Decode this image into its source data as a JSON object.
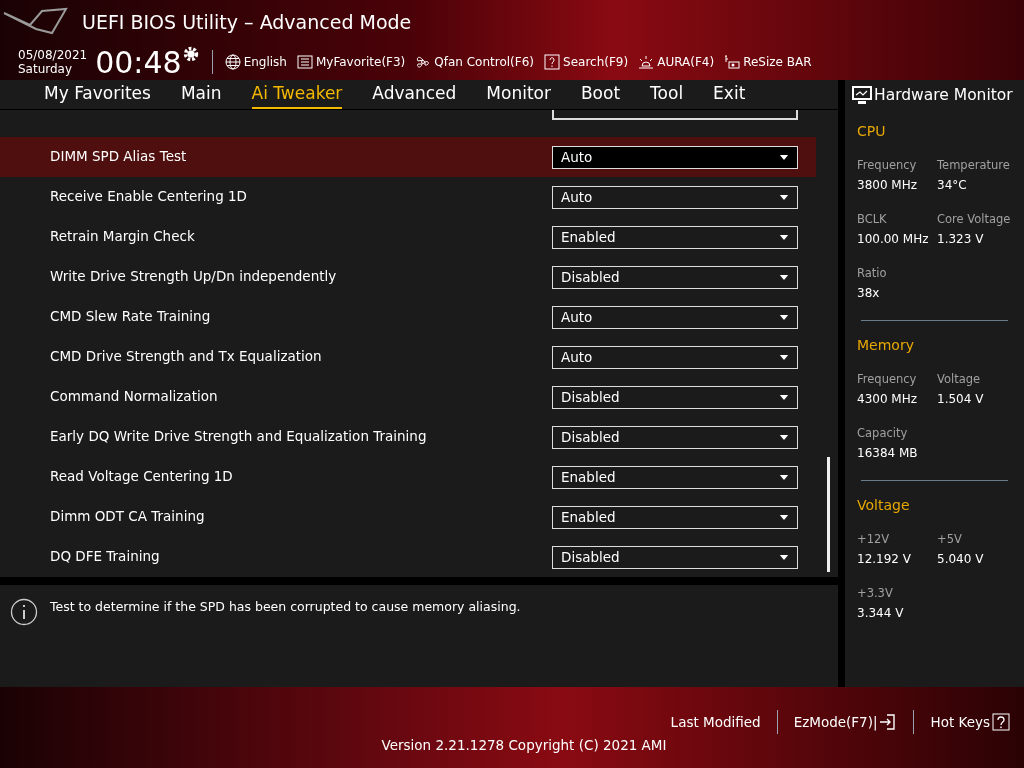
{
  "header": {
    "title": "UEFI BIOS Utility – Advanced Mode",
    "date": "05/08/2021",
    "day": "Saturday",
    "time": "00:48",
    "tools": [
      {
        "kind": "globe",
        "label": "English"
      },
      {
        "kind": "favorite",
        "label": "MyFavorite(F3)"
      },
      {
        "kind": "fan",
        "label": "Qfan Control(F6)"
      },
      {
        "kind": "search",
        "label": "Search(F9)"
      },
      {
        "kind": "aura",
        "label": "AURA(F4)"
      },
      {
        "kind": "resize",
        "label": "ReSize BAR"
      }
    ]
  },
  "tabs": [
    {
      "label": "My Favorites",
      "selected": false
    },
    {
      "label": "Main",
      "selected": false
    },
    {
      "label": "Ai Tweaker",
      "selected": true
    },
    {
      "label": "Advanced",
      "selected": false
    },
    {
      "label": "Monitor",
      "selected": false
    },
    {
      "label": "Boot",
      "selected": false
    },
    {
      "label": "Tool",
      "selected": false
    },
    {
      "label": "Exit",
      "selected": false
    }
  ],
  "settings": [
    {
      "label": "DIMM SPD Alias Test",
      "value": "Auto",
      "selected": true
    },
    {
      "label": "Receive Enable Centering 1D",
      "value": "Auto",
      "selected": false
    },
    {
      "label": "Retrain Margin Check",
      "value": "Enabled",
      "selected": false
    },
    {
      "label": "Write Drive Strength Up/Dn independently",
      "value": "Disabled",
      "selected": false
    },
    {
      "label": "CMD Slew Rate Training",
      "value": "Auto",
      "selected": false
    },
    {
      "label": "CMD Drive Strength and Tx Equalization",
      "value": "Auto",
      "selected": false
    },
    {
      "label": "Command Normalization",
      "value": "Disabled",
      "selected": false
    },
    {
      "label": "Early DQ Write Drive Strength and Equalization Training",
      "value": "Disabled",
      "selected": false
    },
    {
      "label": "Read Voltage Centering 1D",
      "value": "Enabled",
      "selected": false
    },
    {
      "label": "Dimm ODT CA Training",
      "value": "Enabled",
      "selected": false
    },
    {
      "label": "DQ DFE Training",
      "value": "Disabled",
      "selected": false
    }
  ],
  "help_text": "Test to determine if the SPD has been corrupted to cause memory aliasing.",
  "hardware_monitor": {
    "title": "Hardware Monitor",
    "sections": [
      {
        "title": "CPU",
        "items": [
          {
            "label": "Frequency",
            "value": "3800 MHz"
          },
          {
            "label": "Temperature",
            "value": "34°C"
          },
          {
            "label": "BCLK",
            "value": "100.00 MHz"
          },
          {
            "label": "Core Voltage",
            "value": "1.323 V"
          },
          {
            "label": "Ratio",
            "value": "38x"
          }
        ]
      },
      {
        "title": "Memory",
        "items": [
          {
            "label": "Frequency",
            "value": "4300 MHz"
          },
          {
            "label": "Voltage",
            "value": "1.504 V"
          },
          {
            "label": "Capacity",
            "value": "16384 MB"
          }
        ]
      },
      {
        "title": "Voltage",
        "items": [
          {
            "label": "+12V",
            "value": "12.192 V"
          },
          {
            "label": "+5V",
            "value": "5.040 V"
          },
          {
            "label": "+3.3V",
            "value": "3.344 V"
          }
        ]
      }
    ]
  },
  "footer": {
    "buttons": [
      {
        "kind": "text",
        "label": "Last Modified"
      },
      {
        "kind": "exit",
        "label": "EzMode(F7)|"
      },
      {
        "kind": "help",
        "label": "Hot Keys"
      }
    ],
    "version": "Version 2.21.1278 Copyright (C) 2021 AMI"
  }
}
